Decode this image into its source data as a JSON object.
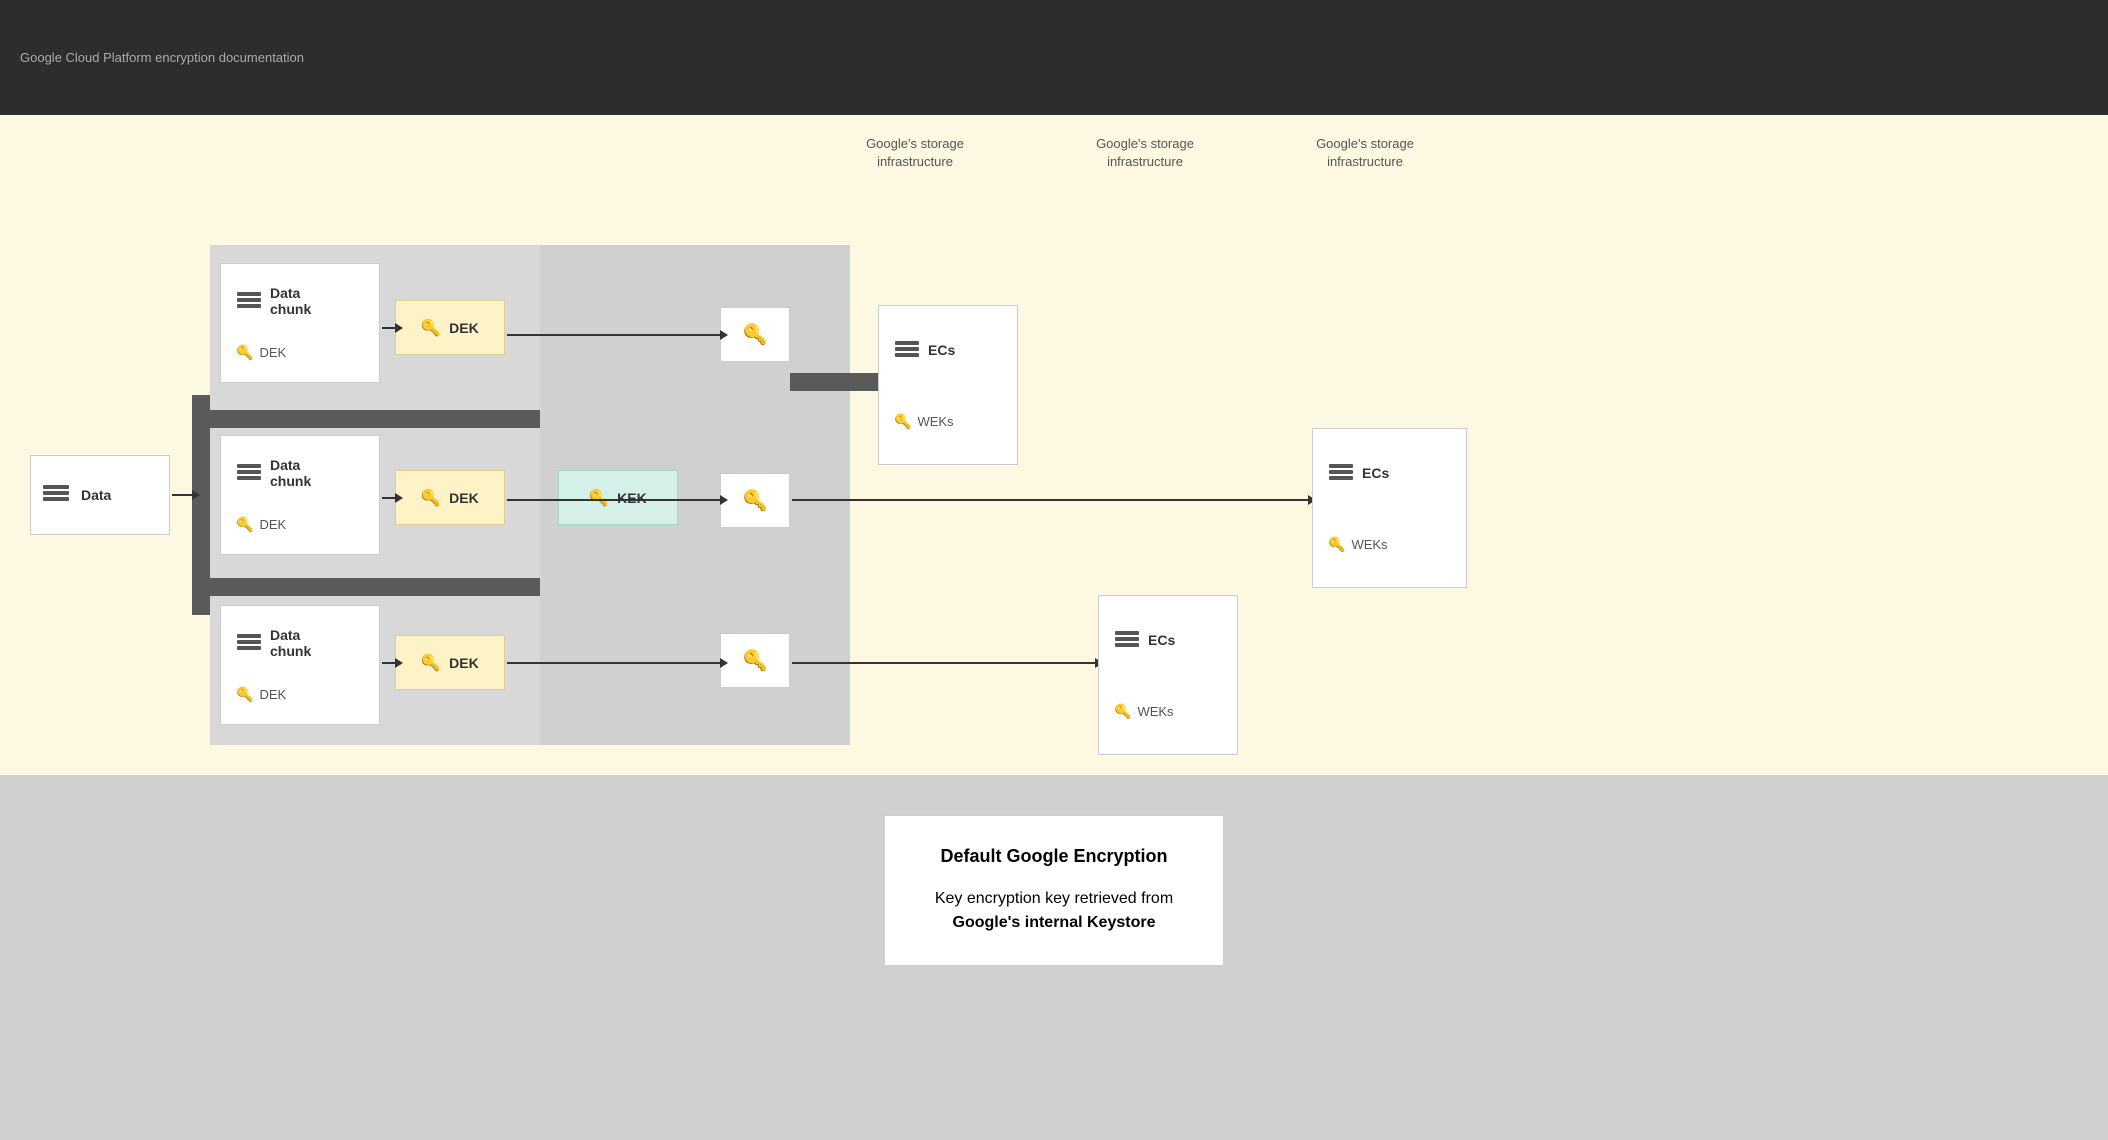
{
  "toolbar": {
    "content": "Google Cloud Platform encryption documentation"
  },
  "diagram": {
    "section_labels": [
      "Google's storage\ninfrastructure",
      "Google's storage\ninfrastructure",
      "Google's storage\ninfrastructure"
    ],
    "data_box": "Data",
    "chunks": [
      {
        "title": "Data chunk",
        "sublabel": "DEK"
      },
      {
        "title": "Data chunk",
        "sublabel": "DEK"
      },
      {
        "title": "Data chunk",
        "sublabel": "DEK"
      }
    ],
    "dek_boxes": [
      "DEK",
      "DEK",
      "DEK"
    ],
    "kek_box": "KEK",
    "storage_boxes": [
      {
        "top": "ECs",
        "bottom": "WEKs"
      },
      {
        "top": "ECs",
        "bottom": "WEKs"
      },
      {
        "top": "ECs",
        "bottom": "WEKs"
      }
    ]
  },
  "legend": {
    "title": "Default Google Encryption",
    "description": "Key encryption key retrieved from\nGoogle's internal Keystore"
  }
}
